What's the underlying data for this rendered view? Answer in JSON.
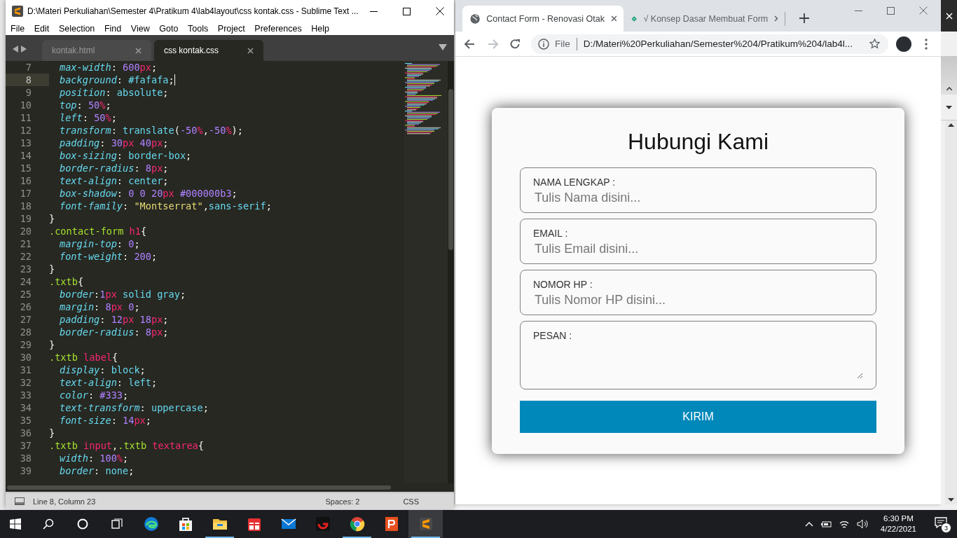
{
  "editor": {
    "title": "D:\\Materi Perkuliahan\\Semester 4\\Pratikum 4\\lab4layout\\css kontak.css - Sublime Text ...",
    "menu": [
      "File",
      "Edit",
      "Selection",
      "Find",
      "View",
      "Goto",
      "Tools",
      "Project",
      "Preferences",
      "Help"
    ],
    "tabs": [
      {
        "label": "kontak.html",
        "selected": false
      },
      {
        "label": "css kontak.css",
        "selected": true
      }
    ],
    "lines": [
      {
        "number": "7",
        "current": false,
        "indent": true,
        "tokens": [
          {
            "kind": "prop",
            "text": "max-width"
          },
          {
            "kind": "punct",
            "text": ": "
          },
          {
            "kind": "num",
            "text": "600"
          },
          {
            "kind": "unit",
            "text": "px"
          },
          {
            "kind": "punct",
            "text": ";"
          }
        ]
      },
      {
        "number": "8",
        "current": true,
        "indent": true,
        "tokens": [
          {
            "kind": "prop",
            "text": "background"
          },
          {
            "kind": "punct",
            "text": ": "
          },
          {
            "kind": "value",
            "text": "#fafafa"
          },
          {
            "kind": "punct",
            "text": ";"
          }
        ]
      },
      {
        "number": "9",
        "current": false,
        "indent": true,
        "tokens": [
          {
            "kind": "prop",
            "text": "position"
          },
          {
            "kind": "punct",
            "text": ": "
          },
          {
            "kind": "value",
            "text": "absolute"
          },
          {
            "kind": "punct",
            "text": ";"
          }
        ]
      },
      {
        "number": "10",
        "current": false,
        "indent": true,
        "tokens": [
          {
            "kind": "prop",
            "text": "top"
          },
          {
            "kind": "punct",
            "text": ": "
          },
          {
            "kind": "num",
            "text": "50"
          },
          {
            "kind": "unit",
            "text": "%"
          },
          {
            "kind": "punct",
            "text": ";"
          }
        ]
      },
      {
        "number": "11",
        "current": false,
        "indent": true,
        "tokens": [
          {
            "kind": "prop",
            "text": "left"
          },
          {
            "kind": "punct",
            "text": ": "
          },
          {
            "kind": "num",
            "text": "50"
          },
          {
            "kind": "unit",
            "text": "%"
          },
          {
            "kind": "punct",
            "text": ";"
          }
        ]
      },
      {
        "number": "12",
        "current": false,
        "indent": true,
        "tokens": [
          {
            "kind": "prop",
            "text": "transform"
          },
          {
            "kind": "punct",
            "text": ": "
          },
          {
            "kind": "value",
            "text": "translate"
          },
          {
            "kind": "punct",
            "text": "("
          },
          {
            "kind": "num",
            "text": "-50"
          },
          {
            "kind": "unit",
            "text": "%"
          },
          {
            "kind": "punct",
            "text": ","
          },
          {
            "kind": "num",
            "text": "-50"
          },
          {
            "kind": "unit",
            "text": "%"
          },
          {
            "kind": "punct",
            "text": ");"
          }
        ]
      },
      {
        "number": "13",
        "current": false,
        "indent": true,
        "tokens": [
          {
            "kind": "prop",
            "text": "padding"
          },
          {
            "kind": "punct",
            "text": ": "
          },
          {
            "kind": "num",
            "text": "30"
          },
          {
            "kind": "unit",
            "text": "px"
          },
          {
            "kind": "num",
            "text": " 40"
          },
          {
            "kind": "unit",
            "text": "px"
          },
          {
            "kind": "punct",
            "text": ";"
          }
        ]
      },
      {
        "number": "14",
        "current": false,
        "indent": true,
        "tokens": [
          {
            "kind": "prop",
            "text": "box-sizing"
          },
          {
            "kind": "punct",
            "text": ": "
          },
          {
            "kind": "value",
            "text": "border-box"
          },
          {
            "kind": "punct",
            "text": ";"
          }
        ]
      },
      {
        "number": "15",
        "current": false,
        "indent": true,
        "tokens": [
          {
            "kind": "prop",
            "text": "border-radius"
          },
          {
            "kind": "punct",
            "text": ": "
          },
          {
            "kind": "num",
            "text": "8"
          },
          {
            "kind": "unit",
            "text": "px"
          },
          {
            "kind": "punct",
            "text": ";"
          }
        ]
      },
      {
        "number": "16",
        "current": false,
        "indent": true,
        "tokens": [
          {
            "kind": "prop",
            "text": "text-align"
          },
          {
            "kind": "punct",
            "text": ": "
          },
          {
            "kind": "value",
            "text": "center"
          },
          {
            "kind": "punct",
            "text": ";"
          }
        ]
      },
      {
        "number": "17",
        "current": false,
        "indent": true,
        "tokens": [
          {
            "kind": "prop",
            "text": "box-shadow"
          },
          {
            "kind": "punct",
            "text": ": "
          },
          {
            "kind": "num",
            "text": "0"
          },
          {
            "kind": "num",
            "text": " 0"
          },
          {
            "kind": "num",
            "text": " 20"
          },
          {
            "kind": "unit",
            "text": "px"
          },
          {
            "kind": "num",
            "text": " #000000b3"
          },
          {
            "kind": "punct",
            "text": ";"
          }
        ]
      },
      {
        "number": "18",
        "current": false,
        "indent": true,
        "tokens": [
          {
            "kind": "prop",
            "text": "font-family"
          },
          {
            "kind": "punct",
            "text": ": "
          },
          {
            "kind": "str",
            "text": "\"Montserrat\""
          },
          {
            "kind": "punct",
            "text": ","
          },
          {
            "kind": "value",
            "text": "sans-serif"
          },
          {
            "kind": "punct",
            "text": ";"
          }
        ]
      },
      {
        "number": "19",
        "current": false,
        "indent": false,
        "tokens": [
          {
            "kind": "punct",
            "text": "}"
          }
        ]
      },
      {
        "number": "20",
        "current": false,
        "indent": false,
        "tokens": [
          {
            "kind": "sel",
            "text": ".contact-form"
          },
          {
            "kind": "tag",
            "text": " h1"
          },
          {
            "kind": "punct",
            "text": "{"
          }
        ]
      },
      {
        "number": "21",
        "current": false,
        "indent": true,
        "tokens": [
          {
            "kind": "prop",
            "text": "margin-top"
          },
          {
            "kind": "punct",
            "text": ": "
          },
          {
            "kind": "num",
            "text": "0"
          },
          {
            "kind": "punct",
            "text": ";"
          }
        ]
      },
      {
        "number": "22",
        "current": false,
        "indent": true,
        "tokens": [
          {
            "kind": "prop",
            "text": "font-weight"
          },
          {
            "kind": "punct",
            "text": ": "
          },
          {
            "kind": "num",
            "text": "200"
          },
          {
            "kind": "punct",
            "text": ";"
          }
        ]
      },
      {
        "number": "23",
        "current": false,
        "indent": false,
        "tokens": [
          {
            "kind": "punct",
            "text": "}"
          }
        ]
      },
      {
        "number": "24",
        "current": false,
        "indent": false,
        "tokens": [
          {
            "kind": "sel",
            "text": ".txtb"
          },
          {
            "kind": "punct",
            "text": "{"
          }
        ]
      },
      {
        "number": "25",
        "current": false,
        "indent": true,
        "tokens": [
          {
            "kind": "prop",
            "text": "border"
          },
          {
            "kind": "punct",
            "text": ":"
          },
          {
            "kind": "num",
            "text": "1"
          },
          {
            "kind": "unit",
            "text": "px"
          },
          {
            "kind": "value",
            "text": " solid gray"
          },
          {
            "kind": "punct",
            "text": ";"
          }
        ]
      },
      {
        "number": "26",
        "current": false,
        "indent": true,
        "tokens": [
          {
            "kind": "prop",
            "text": "margin"
          },
          {
            "kind": "punct",
            "text": ": "
          },
          {
            "kind": "num",
            "text": "8"
          },
          {
            "kind": "unit",
            "text": "px"
          },
          {
            "kind": "num",
            "text": " 0"
          },
          {
            "kind": "punct",
            "text": ";"
          }
        ]
      },
      {
        "number": "27",
        "current": false,
        "indent": true,
        "tokens": [
          {
            "kind": "prop",
            "text": "padding"
          },
          {
            "kind": "punct",
            "text": ": "
          },
          {
            "kind": "num",
            "text": "12"
          },
          {
            "kind": "unit",
            "text": "px"
          },
          {
            "kind": "num",
            "text": " 18"
          },
          {
            "kind": "unit",
            "text": "px"
          },
          {
            "kind": "punct",
            "text": ";"
          }
        ]
      },
      {
        "number": "28",
        "current": false,
        "indent": true,
        "tokens": [
          {
            "kind": "prop",
            "text": "border-radius"
          },
          {
            "kind": "punct",
            "text": ": "
          },
          {
            "kind": "num",
            "text": "8"
          },
          {
            "kind": "unit",
            "text": "px"
          },
          {
            "kind": "punct",
            "text": ";"
          }
        ]
      },
      {
        "number": "29",
        "current": false,
        "indent": false,
        "tokens": [
          {
            "kind": "punct",
            "text": "}"
          }
        ]
      },
      {
        "number": "30",
        "current": false,
        "indent": false,
        "tokens": [
          {
            "kind": "sel",
            "text": ".txtb"
          },
          {
            "kind": "tag",
            "text": " label"
          },
          {
            "kind": "punct",
            "text": "{"
          }
        ]
      },
      {
        "number": "31",
        "current": false,
        "indent": true,
        "tokens": [
          {
            "kind": "prop",
            "text": "display"
          },
          {
            "kind": "punct",
            "text": ": "
          },
          {
            "kind": "value",
            "text": "block"
          },
          {
            "kind": "punct",
            "text": ";"
          }
        ]
      },
      {
        "number": "32",
        "current": false,
        "indent": true,
        "tokens": [
          {
            "kind": "prop",
            "text": "text-align"
          },
          {
            "kind": "punct",
            "text": ": "
          },
          {
            "kind": "value",
            "text": "left"
          },
          {
            "kind": "punct",
            "text": ";"
          }
        ]
      },
      {
        "number": "33",
        "current": false,
        "indent": true,
        "tokens": [
          {
            "kind": "prop",
            "text": "color"
          },
          {
            "kind": "punct",
            "text": ": "
          },
          {
            "kind": "num",
            "text": "#333"
          },
          {
            "kind": "punct",
            "text": ";"
          }
        ]
      },
      {
        "number": "34",
        "current": false,
        "indent": true,
        "tokens": [
          {
            "kind": "prop",
            "text": "text-transform"
          },
          {
            "kind": "punct",
            "text": ": "
          },
          {
            "kind": "value",
            "text": "uppercase"
          },
          {
            "kind": "punct",
            "text": ";"
          }
        ]
      },
      {
        "number": "35",
        "current": false,
        "indent": true,
        "tokens": [
          {
            "kind": "prop",
            "text": "font-size"
          },
          {
            "kind": "punct",
            "text": ": "
          },
          {
            "kind": "num",
            "text": "14"
          },
          {
            "kind": "unit",
            "text": "px"
          },
          {
            "kind": "punct",
            "text": ";"
          }
        ]
      },
      {
        "number": "36",
        "current": false,
        "indent": false,
        "tokens": [
          {
            "kind": "punct",
            "text": "}"
          }
        ]
      },
      {
        "number": "37",
        "current": false,
        "indent": false,
        "tokens": [
          {
            "kind": "sel",
            "text": ".txtb"
          },
          {
            "kind": "tag",
            "text": " input"
          },
          {
            "kind": "punct",
            "text": ","
          },
          {
            "kind": "sel",
            "text": ".txtb"
          },
          {
            "kind": "tag",
            "text": " textarea"
          },
          {
            "kind": "punct",
            "text": "{"
          }
        ]
      },
      {
        "number": "38",
        "current": false,
        "indent": true,
        "tokens": [
          {
            "kind": "prop",
            "text": "width"
          },
          {
            "kind": "punct",
            "text": ": "
          },
          {
            "kind": "num",
            "text": "100"
          },
          {
            "kind": "unit",
            "text": "%"
          },
          {
            "kind": "punct",
            "text": ";"
          }
        ]
      },
      {
        "number": "39",
        "current": false,
        "indent": true,
        "tokens": [
          {
            "kind": "prop",
            "text": "border"
          },
          {
            "kind": "punct",
            "text": ": "
          },
          {
            "kind": "value",
            "text": "none"
          },
          {
            "kind": "punct",
            "text": ";"
          }
        ]
      }
    ],
    "status_bar": {
      "position": "Line 8, Column 23",
      "indentation": "Spaces: 2",
      "syntax": "CSS"
    }
  },
  "browser": {
    "tabs": [
      {
        "title": "Contact Form - Renovasi Otak",
        "selected": true
      },
      {
        "title": "√ Konsep Dasar Membuat Form",
        "selected": false
      }
    ],
    "address": {
      "scheme": "File",
      "url": "D:/Materi%20Perkuliahan/Semester%204/Pratikum%204/lab4l..."
    },
    "page": {
      "heading": "Hubungi Kami",
      "fields": [
        {
          "kind": "input",
          "label": "NAMA LENGKAP :",
          "placeholder": "Tulis Nama disini..."
        },
        {
          "kind": "input",
          "label": "EMAIL :",
          "placeholder": "Tulis Email disini..."
        },
        {
          "kind": "input",
          "label": "NOMOR HP :",
          "placeholder": "Tulis Nomor HP disini..."
        },
        {
          "kind": "textarea",
          "label": "PESAN :"
        }
      ],
      "submit": "KIRIM"
    }
  },
  "taskbar": {
    "apps": [
      {
        "running": false,
        "active": false
      },
      {
        "running": false,
        "active": false
      },
      {
        "running": true,
        "active": false
      },
      {
        "running": false,
        "active": false
      },
      {
        "running": false,
        "active": false
      },
      {
        "running": false,
        "active": false
      },
      {
        "running": true,
        "active": false
      },
      {
        "running": false,
        "active": false
      },
      {
        "running": true,
        "active": true
      }
    ],
    "time": "6:30 PM",
    "date": "4/22/2021",
    "notifications": "3"
  }
}
